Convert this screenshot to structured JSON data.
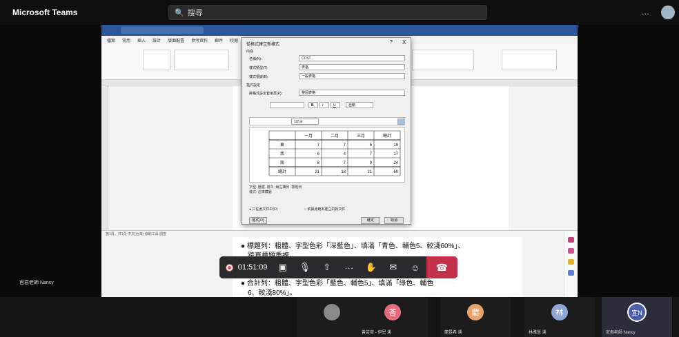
{
  "app": {
    "title": "Microsoft Teams",
    "search_placeholder": "搜尋",
    "more": "..."
  },
  "word": {
    "ribbon_tabs": [
      "檔案",
      "常用",
      "插入",
      "設計",
      "版面配置",
      "參考資料",
      "郵件",
      "校閱"
    ],
    "status": "第1頁，共1頁   中文(台灣)   協助工具:調查"
  },
  "dialog": {
    "title": "從格式建立新樣式",
    "help": "?",
    "close": "X",
    "section_props": "內容",
    "name_label": "名稱(N):",
    "name_value": "CCST",
    "type_label": "樣式類型(T):",
    "type_value": "表格",
    "base_label": "樣式根據(B):",
    "base_value": "一般表格",
    "section_format": "格式設定",
    "apply_label": "將格式設定套用至(P):",
    "apply_value": "整個表格",
    "line_weight": "1/2 pt",
    "font_size": "自動",
    "desc_line1": "字型: 粗體, 置中, 最左欄列: 標題列",
    "desc_line2": "樣式: 在庫藏廳",
    "radio_doc": "只在此文件中(D)",
    "radio_template": "依據此範本建立的新文件",
    "format_btn": "格式(O)",
    "ok_btn": "確定",
    "cancel_btn": "取消"
  },
  "document": {
    "bullet1": "標題列：粗體、字型色彩「深藍色」、填滿「青色、輔色5、較淺60%」、",
    "bullet1b": "跨頁標題重複。",
    "bullet2": "合計列：粗體、字型色彩「藍色、輔色5」、填滿「綠色、輔色",
    "bullet2b": "6、較淺80%」。"
  },
  "controls": {
    "timer": "01:51:09"
  },
  "presenter": {
    "name": "官君老師 Nancy"
  },
  "participants": [
    {
      "initial": "",
      "name": "",
      "color": "#8a8a8a"
    },
    {
      "initial": "荅",
      "name": "曾芸荷 - 伊恩 溪",
      "color": "#e56b7d"
    },
    {
      "initial": "藺",
      "name": "藺昱希 溪",
      "color": "#e8a36a"
    },
    {
      "initial": "林",
      "name": "林雅慧 溪",
      "color": "#8fa6d6"
    },
    {
      "initial": "宜N",
      "name": "官君老師 Nancy",
      "color": "#4c5fa8"
    }
  ],
  "chart_data": {
    "type": "table",
    "columns": [
      "",
      "一月",
      "二月",
      "三月",
      "總計"
    ],
    "rows": [
      {
        "label": "東",
        "values": [
          7,
          7,
          5,
          19
        ]
      },
      {
        "label": "西",
        "values": [
          6,
          4,
          7,
          17
        ]
      },
      {
        "label": "南",
        "values": [
          8,
          7,
          9,
          24
        ]
      },
      {
        "label": "總計",
        "values": [
          21,
          18,
          21,
          60
        ]
      }
    ]
  }
}
